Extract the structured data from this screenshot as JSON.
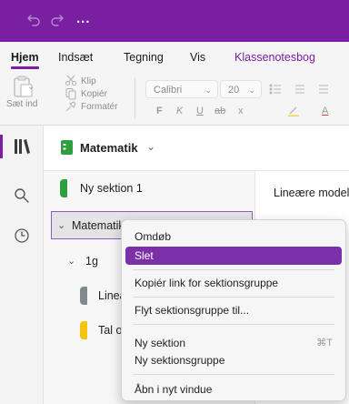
{
  "titlebar": {
    "more_label": "..."
  },
  "tabs": [
    {
      "label": "Hjem"
    },
    {
      "label": "Indsæt"
    },
    {
      "label": "Tegning"
    },
    {
      "label": "Vis"
    },
    {
      "label": "Klassenotesbog"
    }
  ],
  "ribbon": {
    "clip": "Klip",
    "copy": "Kopiér",
    "paste": "Sæt ind",
    "format": "Formatér",
    "font": "Calibri",
    "size": "20",
    "format_glyphs": [
      "F",
      "K",
      "U",
      "ab",
      "x",
      "A"
    ]
  },
  "notebook": {
    "name": "Matematik"
  },
  "sections": [
    {
      "label": "Ny sektion 1",
      "color": "#2e9e3e"
    },
    {
      "label": "Matematik"
    },
    {
      "label": "1g"
    },
    {
      "label": "Lineære modeller",
      "color": "#808a8c"
    },
    {
      "label": "Tal og regneregler",
      "color": "#f2c40c"
    }
  ],
  "page": {
    "title": "Lineære modeller"
  },
  "context_menu": {
    "items": [
      {
        "label": "Omdøb"
      },
      {
        "label": "Slet"
      },
      {
        "label": "Kopiér link for sektionsgruppe"
      },
      {
        "label": "Flyt sektionsgruppe til..."
      },
      {
        "label": "Ny sektion",
        "shortcut": "⌘T"
      },
      {
        "label": "Ny sektionsgruppe"
      },
      {
        "label": "Åbn i nyt vindue"
      }
    ]
  },
  "colors": {
    "accent": "#7a1fa2",
    "menu_highlight": "#7b2fa8",
    "section_green": "#2e9e3e",
    "section_gray": "#808a8c",
    "section_yellow": "#f2c40c"
  },
  "icons": [
    "undo-icon",
    "redo-icon",
    "paste-icon",
    "scissors-icon",
    "copy-icon",
    "format-painter-icon",
    "notebooks-icon",
    "search-icon",
    "recent-icon",
    "notebook-icon"
  ]
}
